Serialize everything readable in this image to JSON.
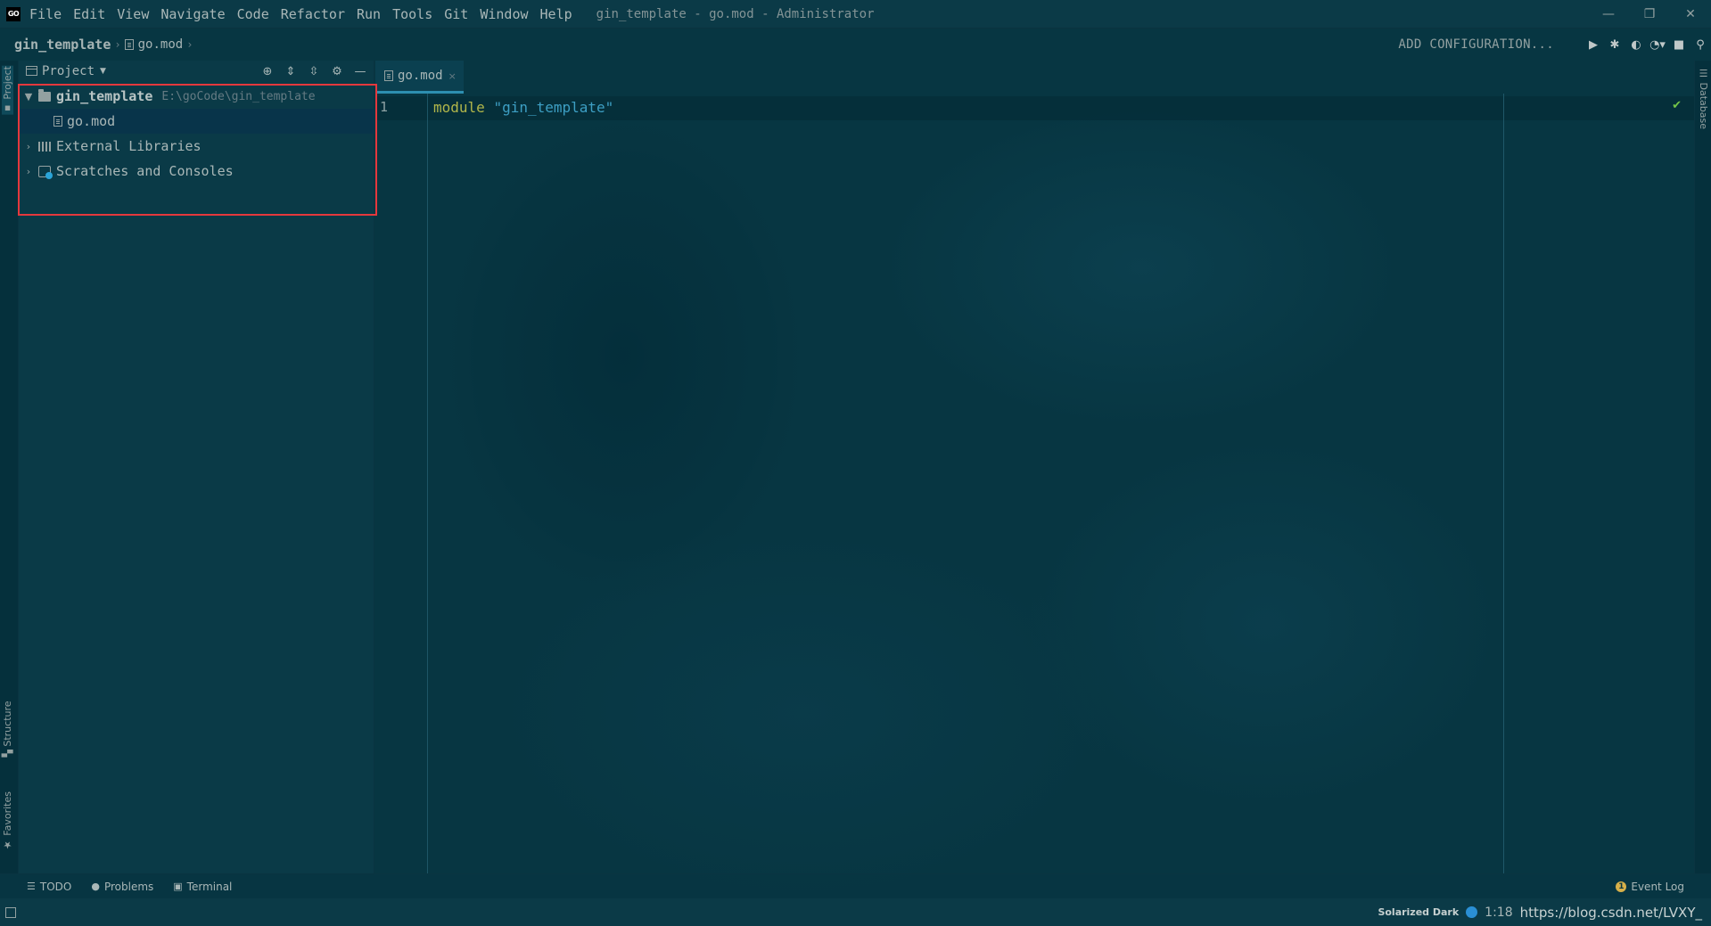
{
  "window": {
    "app_logo": "GO",
    "title": "gin_template - go.mod - Administrator",
    "controls": {
      "minimize": "—",
      "restore": "❐",
      "close": "✕"
    }
  },
  "menu": [
    "File",
    "Edit",
    "View",
    "Navigate",
    "Code",
    "Refactor",
    "Run",
    "Tools",
    "Git",
    "Window",
    "Help"
  ],
  "navbar": {
    "project": "gin_template",
    "file": "go.mod",
    "add_configuration": "ADD CONFIGURATION...",
    "toolbar_icons": [
      "run-icon",
      "debug-icon",
      "coverage-icon",
      "profile-icon",
      "stop-icon",
      "search-icon"
    ]
  },
  "left_strip": {
    "tabs": [
      "Project",
      "Structure",
      "Favorites"
    ]
  },
  "right_strip": {
    "tabs": [
      "Database"
    ]
  },
  "project_panel": {
    "title": "Project",
    "tree": {
      "root": {
        "name": "gin_template",
        "path": "E:\\goCode\\gin_template"
      },
      "file": "go.mod",
      "libraries": "External Libraries",
      "scratches": "Scratches and Consoles"
    }
  },
  "editor": {
    "tab_label": "go.mod",
    "tab_close": "×",
    "line_number": "1",
    "keyword": "module",
    "string": "\"gin_template\"",
    "inspection": "✔"
  },
  "bottom_tools": {
    "todo": "TODO",
    "problems": "Problems",
    "terminal": "Terminal",
    "event_log": "Event Log",
    "event_count": "1"
  },
  "status_bar": {
    "theme": "Solarized Dark",
    "cursor": "1:18",
    "watermark": "https://blog.csdn.net/LVXY_"
  },
  "colors": {
    "background": "#073642",
    "keyword": "#b1b64a",
    "string": "#3d9fc4",
    "highlight_box": "#e5383d",
    "check": "#74c548"
  }
}
